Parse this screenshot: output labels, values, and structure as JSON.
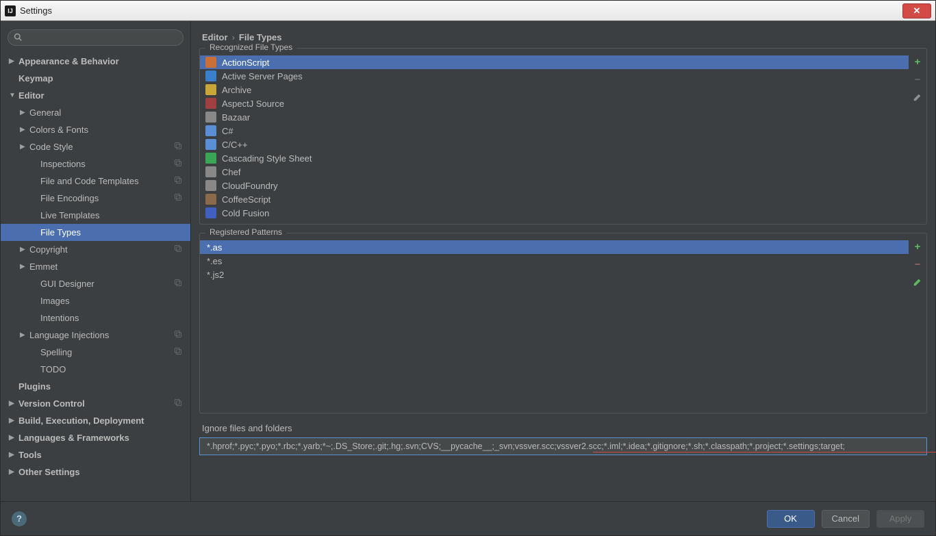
{
  "window": {
    "title": "Settings"
  },
  "breadcrumb": {
    "parent": "Editor",
    "current": "File Types"
  },
  "search": {
    "placeholder": ""
  },
  "sidebar": [
    {
      "label": "Appearance & Behavior",
      "bold": true,
      "arrow": "▶",
      "indent": 0
    },
    {
      "label": "Keymap",
      "bold": true,
      "arrow": "",
      "indent": 0,
      "pad": true
    },
    {
      "label": "Editor",
      "bold": true,
      "arrow": "▼",
      "indent": 0
    },
    {
      "label": "General",
      "arrow": "▶",
      "indent": 1
    },
    {
      "label": "Colors & Fonts",
      "arrow": "▶",
      "indent": 1
    },
    {
      "label": "Code Style",
      "arrow": "▶",
      "indent": 1,
      "scheme": true
    },
    {
      "label": "Inspections",
      "arrow": "",
      "indent": 2,
      "scheme": true
    },
    {
      "label": "File and Code Templates",
      "arrow": "",
      "indent": 2,
      "scheme": true
    },
    {
      "label": "File Encodings",
      "arrow": "",
      "indent": 2,
      "scheme": true
    },
    {
      "label": "Live Templates",
      "arrow": "",
      "indent": 2
    },
    {
      "label": "File Types",
      "arrow": "",
      "indent": 2,
      "selected": true
    },
    {
      "label": "Copyright",
      "arrow": "▶",
      "indent": 1,
      "scheme": true
    },
    {
      "label": "Emmet",
      "arrow": "▶",
      "indent": 1
    },
    {
      "label": "GUI Designer",
      "arrow": "",
      "indent": 2,
      "scheme": true
    },
    {
      "label": "Images",
      "arrow": "",
      "indent": 2
    },
    {
      "label": "Intentions",
      "arrow": "",
      "indent": 2
    },
    {
      "label": "Language Injections",
      "arrow": "▶",
      "indent": 1,
      "scheme": true
    },
    {
      "label": "Spelling",
      "arrow": "",
      "indent": 2,
      "scheme": true
    },
    {
      "label": "TODO",
      "arrow": "",
      "indent": 2
    },
    {
      "label": "Plugins",
      "bold": true,
      "arrow": "",
      "indent": 0,
      "pad": true
    },
    {
      "label": "Version Control",
      "bold": true,
      "arrow": "▶",
      "indent": 0,
      "scheme": true
    },
    {
      "label": "Build, Execution, Deployment",
      "bold": true,
      "arrow": "▶",
      "indent": 0
    },
    {
      "label": "Languages & Frameworks",
      "bold": true,
      "arrow": "▶",
      "indent": 0
    },
    {
      "label": "Tools",
      "bold": true,
      "arrow": "▶",
      "indent": 0
    },
    {
      "label": "Other Settings",
      "bold": true,
      "arrow": "▶",
      "indent": 0
    }
  ],
  "sections": {
    "recognized_label": "Recognized File Types",
    "patterns_label": "Registered Patterns",
    "ignore_label": "Ignore files and folders"
  },
  "file_types": [
    {
      "name": "ActionScript",
      "selected": true,
      "color": "#c96f3a"
    },
    {
      "name": "Active Server Pages",
      "color": "#3a7fc9"
    },
    {
      "name": "Archive",
      "color": "#c9a63a"
    },
    {
      "name": "AspectJ Source",
      "color": "#a04040"
    },
    {
      "name": "Bazaar",
      "color": "#888888"
    },
    {
      "name": "C#",
      "color": "#5a8fd6"
    },
    {
      "name": "C/C++",
      "color": "#5a8fd6"
    },
    {
      "name": "Cascading Style Sheet",
      "color": "#3aa655"
    },
    {
      "name": "Chef",
      "color": "#888888"
    },
    {
      "name": "CloudFoundry",
      "color": "#888888"
    },
    {
      "name": "CoffeeScript",
      "color": "#8a6a4a"
    },
    {
      "name": "Cold Fusion",
      "color": "#4060c0"
    }
  ],
  "patterns": [
    {
      "pattern": "*.as",
      "selected": true
    },
    {
      "pattern": "*.es"
    },
    {
      "pattern": "*.js2"
    }
  ],
  "ignore_value": "*.hprof;*.pyc;*.pyo;*.rbc;*.yarb;*~;.DS_Store;.git;.hg;.svn;CVS;__pycache__;_svn;vssver.scc;vssver2.scc;*.iml;*.idea;*.gitignore;*.sh;*.classpath;*.project;*.settings;target;",
  "buttons": {
    "ok": "OK",
    "cancel": "Cancel",
    "apply": "Apply"
  }
}
